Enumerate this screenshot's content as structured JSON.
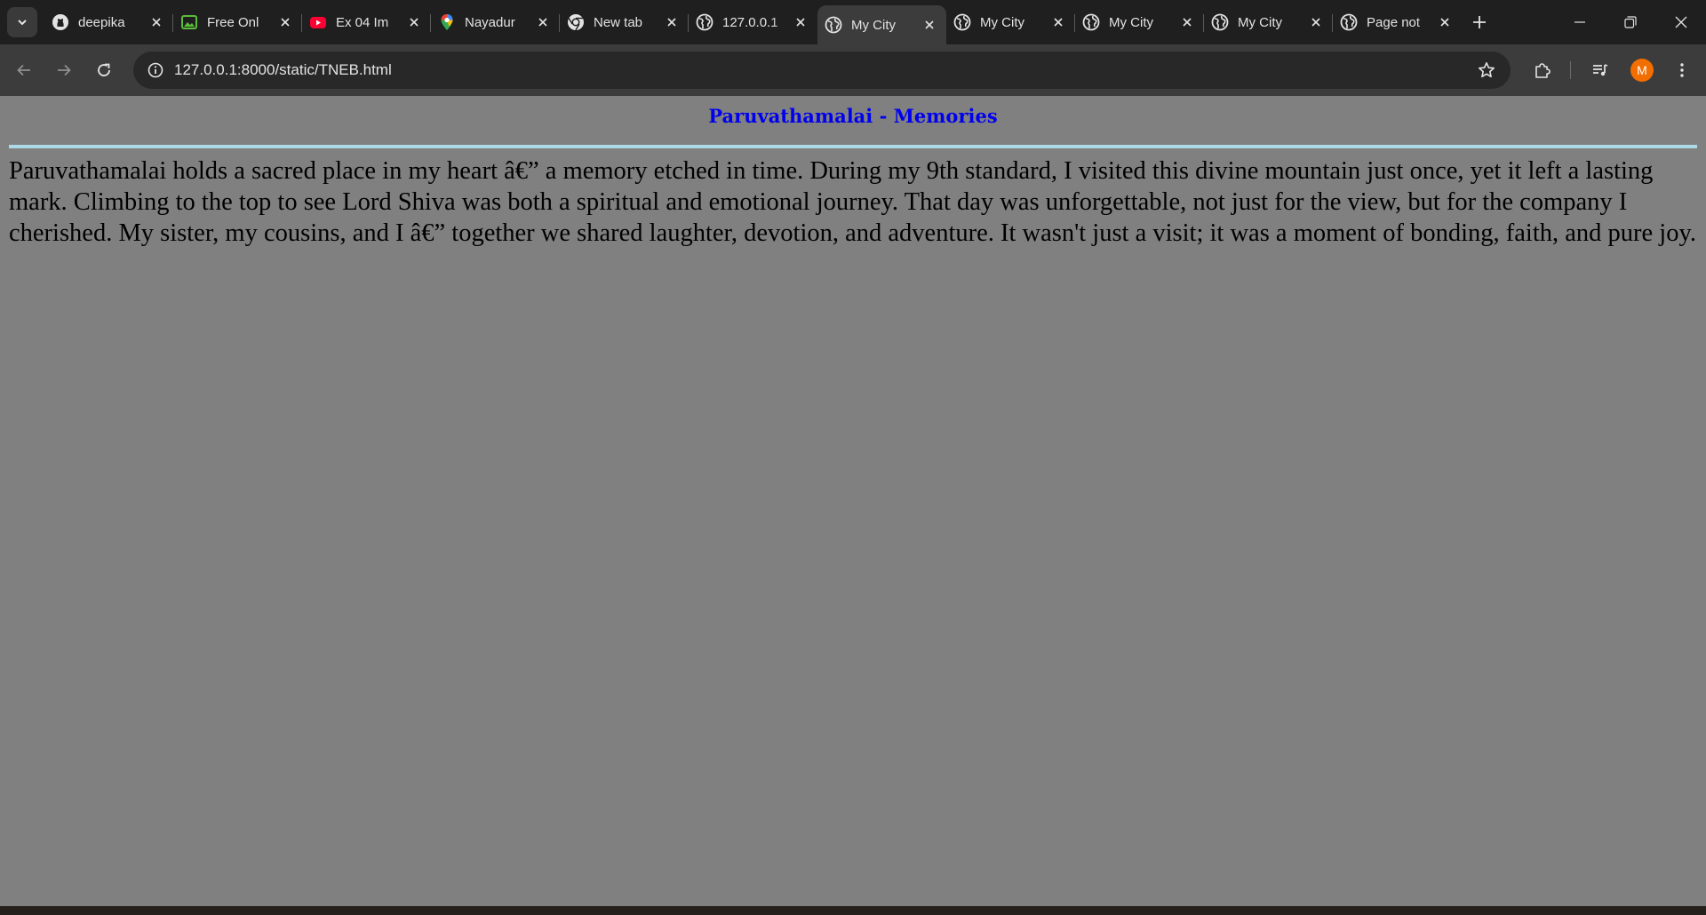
{
  "browser": {
    "tabs": [
      {
        "title": "deepika",
        "icon": "github-icon"
      },
      {
        "title": "Free Onl",
        "icon": "image-app-icon"
      },
      {
        "title": "Ex 04 Im",
        "icon": "youtube-icon"
      },
      {
        "title": "Nayadur",
        "icon": "maps-pin-icon"
      },
      {
        "title": "New tab",
        "icon": "chrome-icon"
      },
      {
        "title": "127.0.0.1",
        "icon": "globe-icon"
      },
      {
        "title": "My City",
        "icon": "globe-icon",
        "active": true
      },
      {
        "title": "My City",
        "icon": "globe-icon"
      },
      {
        "title": "My City",
        "icon": "globe-icon"
      },
      {
        "title": "My City",
        "icon": "globe-icon"
      },
      {
        "title": "Page not",
        "icon": "globe-icon"
      }
    ],
    "address_bar": {
      "url": "127.0.0.1:8000/static/TNEB.html"
    },
    "profile": {
      "initial": "M",
      "color": "#f26e00"
    }
  },
  "page": {
    "heading": "Paruvathamalai - Memories",
    "paragraph": "Paruvathamalai holds a sacred place in my heart â€” a memory etched in time. During my 9th standard, I visited this divine mountain just once, yet it left a lasting mark. Climbing to the top to see Lord Shiva was both a spiritual and emotional journey. That day was unforgettable, not just for the view, but for the company I cherished. My sister, my cousins, and I â€” together we shared laughter, devotion, and adventure. It wasn't just a visit; it was a moment of bonding, faith, and pure joy.",
    "colors": {
      "background": "#808080",
      "heading": "#0000ee",
      "rule": "#add8e6",
      "text": "#000000"
    }
  }
}
